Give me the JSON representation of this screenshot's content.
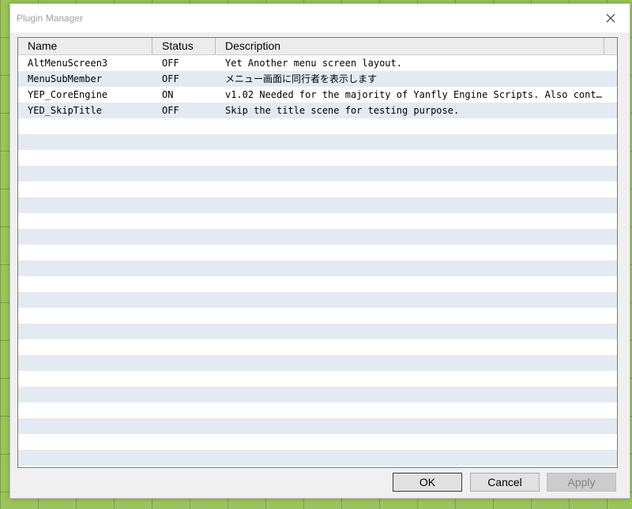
{
  "window": {
    "title": "Plugin Manager"
  },
  "table": {
    "columns": [
      "Name",
      "Status",
      "Description"
    ],
    "rows": [
      {
        "name": "AltMenuScreen3",
        "status": "OFF",
        "description": "Yet Another menu screen layout."
      },
      {
        "name": "MenuSubMember",
        "status": "OFF",
        "description": "メニュー画面に同行者を表示します"
      },
      {
        "name": "YEP_CoreEngine",
        "status": "ON",
        "description": "v1.02 Needed for the majority of Yanfly Engine Scripts. Also contain…"
      },
      {
        "name": "YED_SkipTitle",
        "status": "OFF",
        "description": "Skip the title scene for testing purpose."
      }
    ]
  },
  "buttons": {
    "ok": "OK",
    "cancel": "Cancel",
    "apply": "Apply"
  }
}
